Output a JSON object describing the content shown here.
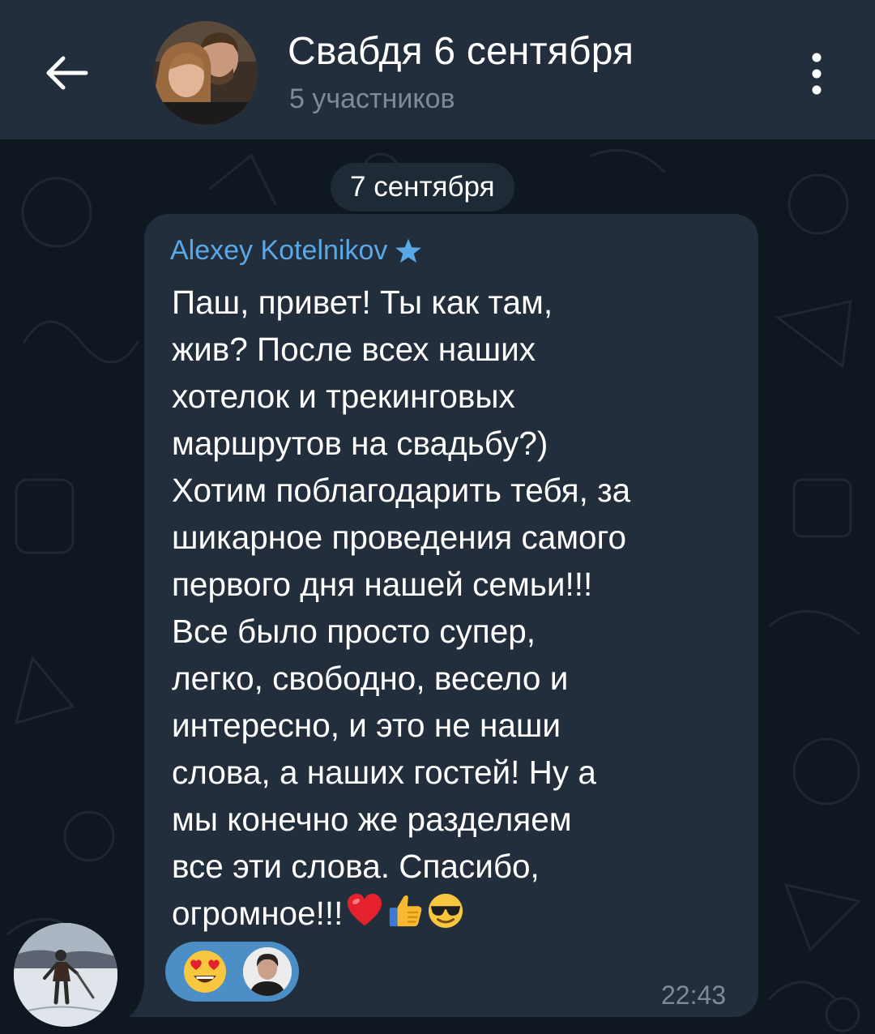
{
  "header": {
    "title": "Свабдя 6 сентября",
    "subtitle": "5 участников",
    "back_icon": "arrow-left-icon",
    "menu_icon": "more-vertical-icon"
  },
  "date_separator": "7 сентября",
  "message": {
    "sender": "Alexey Kotelnikov",
    "sender_badge_icon": "star-icon",
    "text": "Паш, привет! Ты как там,\nжив? После всех наших\nхотелок и трекинговых\nмаршрутов на свадьбу?)\nХотим поблагодарить тебя, за\nшикарное проведения самого\nпервого дня нашей семьи!!!\nВсе было просто супер,\nлегко, свободно, весело и\nинтересно, и это не наши\nслова, а наших гостей! Ну а\nмы конечно же разделяем\nвсе эти слова. Спасибо,\nогромное!!!",
    "trailing_emojis": [
      "red-heart-emoji",
      "thumbs-up-emoji",
      "sunglasses-face-emoji"
    ],
    "time": "22:43",
    "reaction": {
      "emoji": "heart-eyes-emoji",
      "reactor": "user-avatar"
    }
  },
  "colors": {
    "header_bg": "#232e3c",
    "chat_bg": "#0f1720",
    "bubble_bg": "#222e3b",
    "accent": "#5aa8e6",
    "reaction_bg": "#4b8fc6",
    "muted_text": "#7d8b99"
  }
}
